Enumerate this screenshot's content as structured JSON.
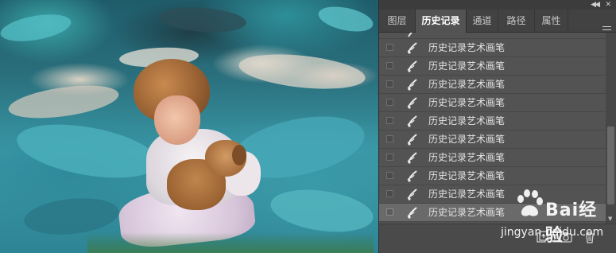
{
  "panel": {
    "tabs": [
      {
        "label": "图层",
        "active": false
      },
      {
        "label": "历史记录",
        "active": true
      },
      {
        "label": "通道",
        "active": false
      },
      {
        "label": "路径",
        "active": false
      },
      {
        "label": "属性",
        "active": false
      }
    ],
    "history_items": [
      {
        "label": "历史记录艺术画笔",
        "icon": "history-art-brush-icon",
        "selected": false
      },
      {
        "label": "历史记录艺术画笔",
        "icon": "history-art-brush-icon",
        "selected": false
      },
      {
        "label": "历史记录艺术画笔",
        "icon": "history-art-brush-icon",
        "selected": false
      },
      {
        "label": "历史记录艺术画笔",
        "icon": "history-art-brush-icon",
        "selected": false
      },
      {
        "label": "历史记录艺术画笔",
        "icon": "history-art-brush-icon",
        "selected": false
      },
      {
        "label": "历史记录艺术画笔",
        "icon": "history-art-brush-icon",
        "selected": false
      },
      {
        "label": "历史记录艺术画笔",
        "icon": "history-art-brush-icon",
        "selected": false
      },
      {
        "label": "历史记录艺术画笔",
        "icon": "history-art-brush-icon",
        "selected": false
      },
      {
        "label": "历史记录艺术画笔",
        "icon": "history-art-brush-icon",
        "selected": false
      },
      {
        "label": "历史记录艺术画笔",
        "icon": "history-art-brush-icon",
        "selected": true
      }
    ],
    "bottom_icons": [
      "new-document-from-state-icon",
      "new-snapshot-icon",
      "delete-icon"
    ],
    "colors": {
      "panel_bg": "#535353",
      "tab_bar_bg": "#424242",
      "selected_row_bg": "#6a6a6a",
      "text": "#e3e3e3"
    }
  },
  "watermark": {
    "brand": "Bai经验",
    "url": "jingyan.baidu.com"
  }
}
